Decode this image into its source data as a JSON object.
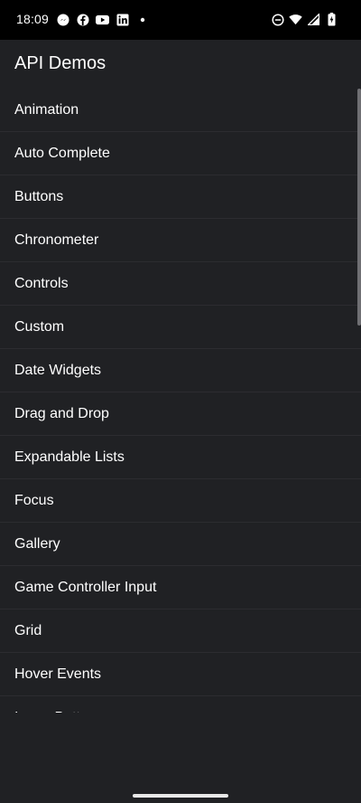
{
  "status_bar": {
    "time": "18:09",
    "notification_icons": [
      "messenger-icon",
      "facebook-icon",
      "youtube-icon",
      "linkedin-icon",
      "dot-icon"
    ],
    "system_icons": [
      "do-not-disturb-icon",
      "wifi-icon",
      "cell-signal-icon",
      "battery-charging-icon"
    ]
  },
  "app_bar": {
    "title": "API Demos"
  },
  "list": {
    "items": [
      {
        "label": "Animation"
      },
      {
        "label": "Auto Complete"
      },
      {
        "label": "Buttons"
      },
      {
        "label": "Chronometer"
      },
      {
        "label": "Controls"
      },
      {
        "label": "Custom"
      },
      {
        "label": "Date Widgets"
      },
      {
        "label": "Drag and Drop"
      },
      {
        "label": "Expandable Lists"
      },
      {
        "label": "Focus"
      },
      {
        "label": "Gallery"
      },
      {
        "label": "Game Controller Input"
      },
      {
        "label": "Grid"
      },
      {
        "label": "Hover Events"
      },
      {
        "label": "ImageButton"
      }
    ]
  },
  "colors": {
    "background": "#202124",
    "status_bar": "#000000",
    "divider": "#2c2c30",
    "text": "#ffffff"
  }
}
